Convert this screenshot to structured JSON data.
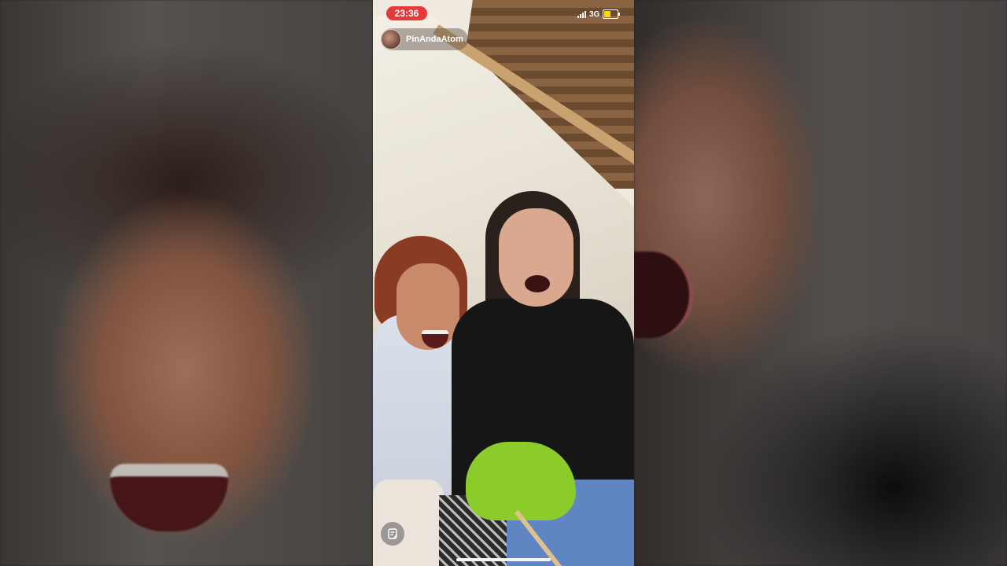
{
  "status_bar": {
    "time": "23:36",
    "network": "3G",
    "battery_color": "#ffd60a",
    "recording_color": "#e63a3a"
  },
  "account": {
    "username": "PinAndaAtom"
  },
  "icons": {
    "notes": "notes-icon",
    "signal": "signal-icon",
    "battery": "battery-icon"
  }
}
